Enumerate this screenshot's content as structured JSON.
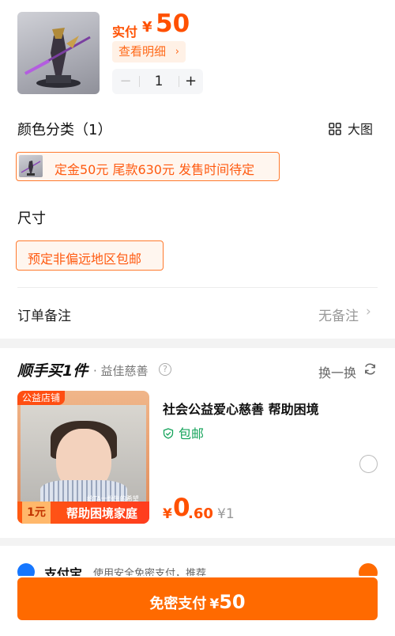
{
  "product": {
    "paid_label": "实付",
    "currency": "¥",
    "paid_value": "50",
    "detail_label": "查看明细",
    "detail_chevron": "›",
    "quantity": "1",
    "minus": "−",
    "plus": "+"
  },
  "color_section": {
    "title": "颜色分类（1）",
    "big_view_label": "大图",
    "option": "定金50元 尾款630元 发售时间待定"
  },
  "size_section": {
    "title": "尺寸",
    "option": "预定非偏远地区包邮"
  },
  "note": {
    "label": "订单备注",
    "value": "无备注",
    "chevron": "›"
  },
  "charity": {
    "brand": "顺手买1件",
    "sub": "· 益佳慈善",
    "help": "?",
    "swap_label": "换一换",
    "card_tag": "公益店铺",
    "card_small": "给TA一份生的希望",
    "card_yuan": "1元",
    "card_slogan": "帮助困境家庭",
    "title": "社会公益爱心慈善 帮助困境",
    "shipping": "包邮",
    "price_yen": "¥",
    "price_int": "0",
    "price_dec": ".60",
    "original_price": "¥1"
  },
  "payment": {
    "method": "支付宝",
    "desc": "使用安全免密支付，推荐"
  },
  "pay_button": {
    "label": "免密支付",
    "yen": "¥",
    "amount": "50"
  },
  "colors": {
    "accent": "#ff6a00",
    "price": "#ff5000",
    "green": "#14a35a"
  }
}
